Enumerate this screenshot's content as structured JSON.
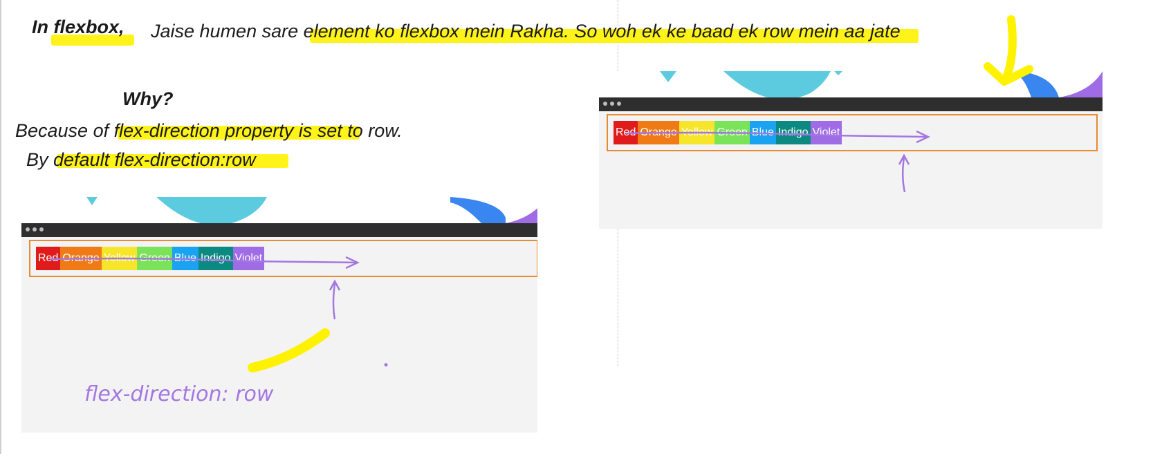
{
  "notes": {
    "heading": "In flexbox,",
    "line1": "Jaise humen sare element ko flexbox mein Rakha. So woh ek ke baad ek row mein  aa jate",
    "why": "Why?",
    "because": "Because of flex-direction property is set to row.",
    "default_line": "By default flex-direction:row"
  },
  "handwriting": {
    "label": "flex-direction: row"
  },
  "flex_items": [
    {
      "label": "Red",
      "color": "#e01b1b"
    },
    {
      "label": "Orange",
      "color": "#f07a15"
    },
    {
      "label": "Yellow",
      "color": "#f7e52b"
    },
    {
      "label": "Green",
      "color": "#7be35a"
    },
    {
      "label": "Blue",
      "color": "#1aa3f0"
    },
    {
      "label": "Indigo",
      "color": "#0c8a82"
    },
    {
      "label": "Violet",
      "color": "#a06ce6"
    }
  ],
  "colors": {
    "highlight": "#fff200",
    "container_border": "#e68a33",
    "titlebar": "#2e2e2e",
    "ink": "#a377e0",
    "decor_cyan": "#5ccbe0",
    "decor_blue": "#3a86f0"
  }
}
